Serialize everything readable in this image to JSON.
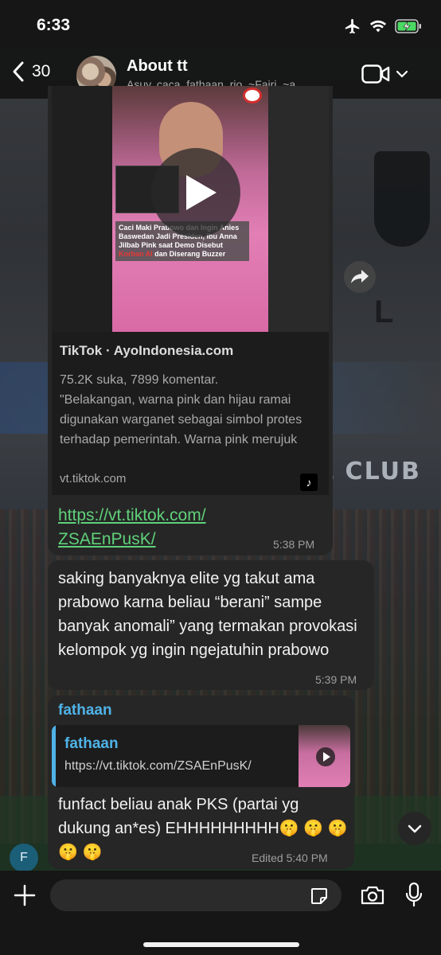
{
  "status_bar": {
    "time": "6:33",
    "icons": [
      "airplane-icon",
      "wifi-icon",
      "battery-charging-icon"
    ]
  },
  "header": {
    "back_count": "30",
    "title": "About tt",
    "members": "Asuy, caca, fathaan, rio, ~Fajri, ~a..."
  },
  "messages": [
    {
      "type": "link_preview",
      "thumbnail_caption_pre": "Caci Maki Prabowo dan Ingin Anies Baswedan Jadi Presiden, Ibu Anna Jilbab Pink saat Demo Disebut ",
      "thumbnail_caption_red": "Korban AI",
      "thumbnail_caption_post": " dan Diserang Buzzer",
      "site": "TikTok · AyoIndonesia.com",
      "meta": "75.2K suka, 7899 komentar.",
      "description": "\"Belakangan, warna pink dan hijau ramai digunakan warganet sebagai simbol protes terhadap pemerintah.  Warna pink merujuk pada jilbab seorang ibu b...",
      "domain": "vt.tiktok.com",
      "url_line1": "https://vt.tiktok.com/",
      "url_line2": "ZSAEnPusK/",
      "time": "5:38 PM"
    },
    {
      "type": "text",
      "text": "saking banyaknya elite yg takut ama prabowo karna beliau “berani” sampe banyak anomali” yang termakan provokasi kelompok yg ingin ngejatuhin prabowo",
      "time": "5:39 PM"
    },
    {
      "type": "reply",
      "sender": "fathaan",
      "quoted_sender": "fathaan",
      "quoted_text": "https://vt.tiktok.com/ZSAEnPusK/",
      "text": "funfact beliau anak PKS (partai yg dukung an*es) EHHHHHHHHH🤫 🤫 🤫 🤫 🤫",
      "time": "Edited 5:40 PM",
      "avatar_letter": "F"
    }
  ],
  "input": {
    "placeholder": ""
  },
  "colors": {
    "bubble": "#262626",
    "link_green": "#5fd17a",
    "sender_blue": "#4fb3e8",
    "bar_bg": "#161616",
    "battery_green": "#4cd964"
  }
}
